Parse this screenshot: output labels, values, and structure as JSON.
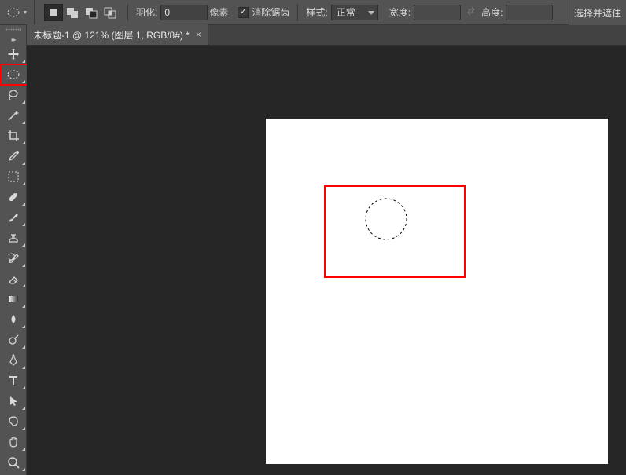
{
  "options": {
    "feather_label": "羽化:",
    "feather_value": "0",
    "feather_unit": "像素",
    "antialias_label": "消除锯齿",
    "style_label": "样式:",
    "style_value": "正常",
    "width_label": "宽度:",
    "width_value": "",
    "height_label": "高度:",
    "height_value": "",
    "select_mask_btn": "选择并遮住"
  },
  "tab": {
    "title": "未标题-1 @ 121% (图层 1, RGB/8#) *",
    "close": "×"
  },
  "tools": [
    {
      "name": "move-tool"
    },
    {
      "name": "elliptical-marquee-tool",
      "highlighted": true
    },
    {
      "name": "lasso-tool"
    },
    {
      "name": "magic-wand-tool"
    },
    {
      "name": "crop-tool"
    },
    {
      "name": "eyedropper-tool"
    },
    {
      "name": "frame-tool"
    },
    {
      "name": "spot-healing-tool"
    },
    {
      "name": "brush-tool"
    },
    {
      "name": "clone-stamp-tool"
    },
    {
      "name": "history-brush-tool"
    },
    {
      "name": "eraser-tool"
    },
    {
      "name": "gradient-tool"
    },
    {
      "name": "blur-tool"
    },
    {
      "name": "dodge-tool"
    },
    {
      "name": "pen-tool"
    },
    {
      "name": "type-tool"
    },
    {
      "name": "path-selection-tool"
    },
    {
      "name": "shape-tool"
    },
    {
      "name": "hand-tool"
    },
    {
      "name": "zoom-tool"
    }
  ]
}
